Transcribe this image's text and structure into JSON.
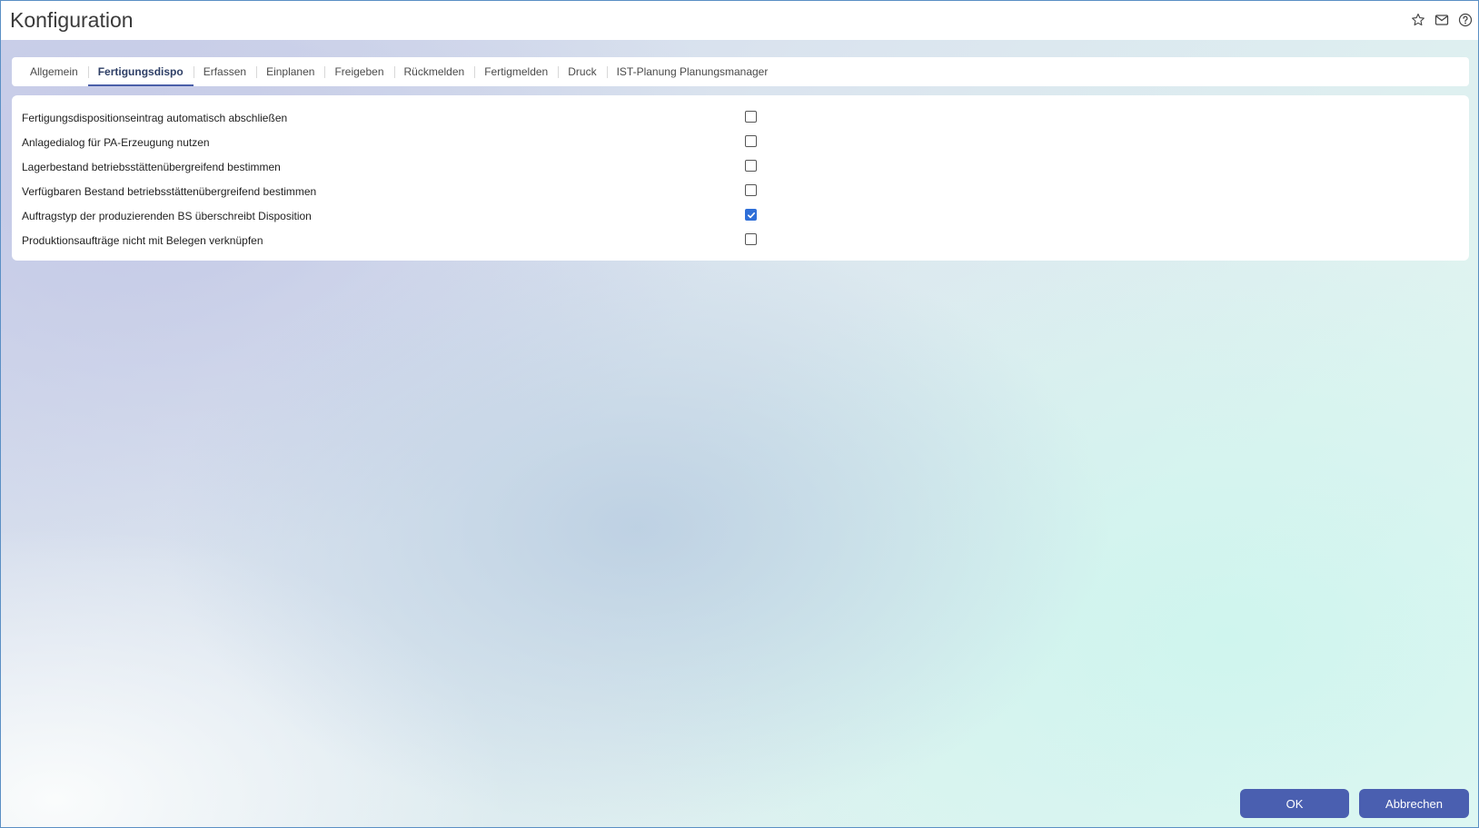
{
  "header": {
    "title": "Konfiguration",
    "icons": [
      "star-icon",
      "mail-icon",
      "help-icon"
    ]
  },
  "tabs": [
    {
      "label": "Allgemein",
      "active": false
    },
    {
      "label": "Fertigungsdispo",
      "active": true
    },
    {
      "label": "Erfassen",
      "active": false
    },
    {
      "label": "Einplanen",
      "active": false
    },
    {
      "label": "Freigeben",
      "active": false
    },
    {
      "label": "Rückmelden",
      "active": false
    },
    {
      "label": "Fertigmelden",
      "active": false
    },
    {
      "label": "Druck",
      "active": false
    },
    {
      "label": "IST-Planung Planungsmanager",
      "active": false
    }
  ],
  "settings": [
    {
      "label": "Fertigungsdispositionseintrag automatisch abschließen",
      "checked": false
    },
    {
      "label": "Anlagedialog für PA-Erzeugung nutzen",
      "checked": false
    },
    {
      "label": "Lagerbestand betriebsstättenübergreifend bestimmen",
      "checked": false
    },
    {
      "label": "Verfügbaren Bestand betriebsstättenübergreifend bestimmen",
      "checked": false
    },
    {
      "label": "Auftragstyp der produzierenden BS überschreibt Disposition",
      "checked": true
    },
    {
      "label": "Produktionsaufträge nicht mit Belegen verknüpfen",
      "checked": false
    }
  ],
  "footer": {
    "ok_label": "OK",
    "cancel_label": "Abbrechen"
  },
  "colors": {
    "accent": "#4a5fb0",
    "checkbox_checked": "#2f6fd8"
  }
}
